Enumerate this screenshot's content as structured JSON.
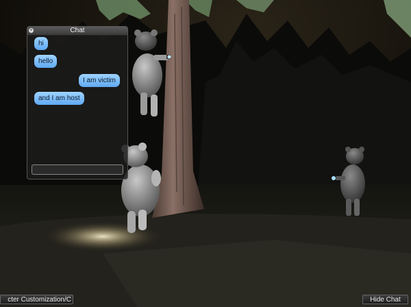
{
  "chat": {
    "title": "Chat",
    "close_icon": "close-icon",
    "messages": [
      {
        "text": "hi",
        "side": "left"
      },
      {
        "text": "hello",
        "side": "left"
      },
      {
        "text": "I am victim",
        "side": "right"
      },
      {
        "text": "and I am host",
        "side": "left"
      }
    ],
    "input_value": "",
    "bubble_color": "#7fc0ff"
  },
  "bottom_bar": {
    "character_button_label": "cter Customization/C",
    "hide_chat_label": "Hide Chat"
  }
}
